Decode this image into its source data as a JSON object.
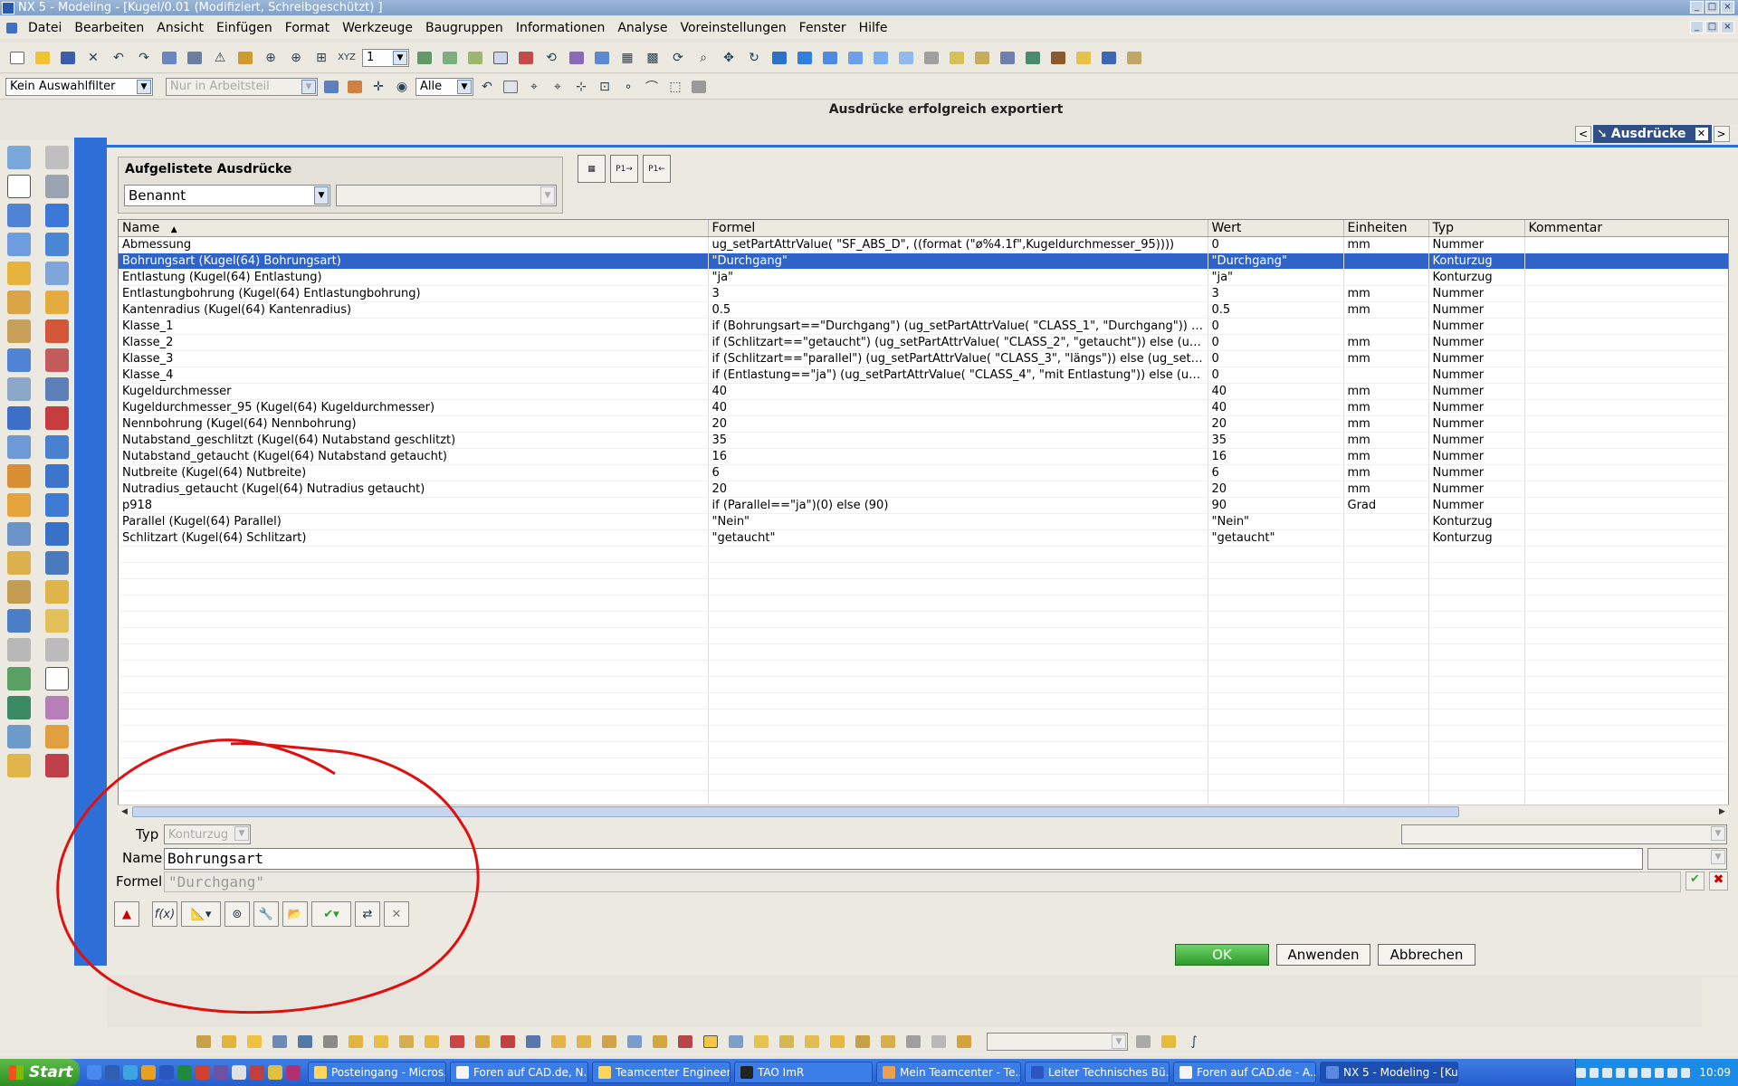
{
  "window": {
    "title": "NX 5 - Modeling - [Kugel/0.01 (Modifiziert, Schreibgeschützt) ]"
  },
  "menu": [
    "Datei",
    "Bearbeiten",
    "Ansicht",
    "Einfügen",
    "Format",
    "Werkzeuge",
    "Baugruppen",
    "Informationen",
    "Analyse",
    "Voreinstellungen",
    "Fenster",
    "Hilfe"
  ],
  "toolbar2": {
    "filter": "Kein Auswahlfilter",
    "workpart": "Nur in Arbeitsteil",
    "scope": "Alle",
    "layer": "1"
  },
  "status_message": "Ausdrücke erfolgreich exportiert",
  "resource_bar": {
    "label": "Ausdrücke"
  },
  "dialog": {
    "filter_group_label": "Aufgelistete Ausdrücke",
    "filter_value": "Benannt",
    "columns": [
      "Name",
      "Formel",
      "Wert",
      "Einheiten",
      "Typ",
      "Kommentar"
    ],
    "rows": [
      {
        "name": "Abmessung",
        "formula": "ug_setPartAttrValue( \"SF_ABS_D\", ((format (\"ø%4.1f\",Kugeldurchmesser_95))))",
        "value": "0",
        "unit": "mm",
        "type": "Nummer",
        "comment": ""
      },
      {
        "name": "Bohrungsart  (Kugel(64) Bohrungsart)",
        "formula": "\"Durchgang\"",
        "value": "\"Durchgang\"",
        "unit": "",
        "type": "Konturzug",
        "comment": "",
        "selected": true
      },
      {
        "name": "Entlastung  (Kugel(64) Entlastung)",
        "formula": "\"ja\"",
        "value": "\"ja\"",
        "unit": "",
        "type": "Konturzug",
        "comment": ""
      },
      {
        "name": "Entlastungbohrung  (Kugel(64) Entlastungbohrung)",
        "formula": "3",
        "value": "3",
        "unit": "mm",
        "type": "Nummer",
        "comment": ""
      },
      {
        "name": "Kantenradius  (Kugel(64) Kantenradius)",
        "formula": "0.5",
        "value": "0.5",
        "unit": "mm",
        "type": "Nummer",
        "comment": ""
      },
      {
        "name": "Klasse_1",
        "formula": "if (Bohrungsart==\"Durchgang\") (ug_setPartAttrValue( \"CLASS_1\", \"Durchgang\")) else (if...",
        "value": "0",
        "unit": "",
        "type": "Nummer",
        "comment": ""
      },
      {
        "name": "Klasse_2",
        "formula": "if (Schlitzart==\"getaucht\") (ug_setPartAttrValue( \"CLASS_2\", \"getaucht\")) else (ug_setP...",
        "value": "0",
        "unit": "mm",
        "type": "Nummer",
        "comment": ""
      },
      {
        "name": "Klasse_3",
        "formula": "if (Schlitzart==\"parallel\") (ug_setPartAttrValue( \"CLASS_3\", \"längs\")) else (ug_setPartAtt...",
        "value": "0",
        "unit": "mm",
        "type": "Nummer",
        "comment": ""
      },
      {
        "name": "Klasse_4",
        "formula": "if (Entlastung==\"ja\") (ug_setPartAttrValue( \"CLASS_4\", \"mit Entlastung\")) else (ug_setPa...",
        "value": "0",
        "unit": "",
        "type": "Nummer",
        "comment": ""
      },
      {
        "name": "Kugeldurchmesser",
        "formula": "40",
        "value": "40",
        "unit": "mm",
        "type": "Nummer",
        "comment": ""
      },
      {
        "name": "Kugeldurchmesser_95  (Kugel(64) Kugeldurchmesser)",
        "formula": "40",
        "value": "40",
        "unit": "mm",
        "type": "Nummer",
        "comment": ""
      },
      {
        "name": "Nennbohrung  (Kugel(64) Nennbohrung)",
        "formula": "20",
        "value": "20",
        "unit": "mm",
        "type": "Nummer",
        "comment": ""
      },
      {
        "name": "Nutabstand_geschlitzt  (Kugel(64) Nutabstand geschlitzt)",
        "formula": "35",
        "value": "35",
        "unit": "mm",
        "type": "Nummer",
        "comment": ""
      },
      {
        "name": "Nutabstand_getaucht  (Kugel(64) Nutabstand getaucht)",
        "formula": "16",
        "value": "16",
        "unit": "mm",
        "type": "Nummer",
        "comment": ""
      },
      {
        "name": "Nutbreite  (Kugel(64) Nutbreite)",
        "formula": "6",
        "value": "6",
        "unit": "mm",
        "type": "Nummer",
        "comment": ""
      },
      {
        "name": "Nutradius_getaucht  (Kugel(64) Nutradius getaucht)",
        "formula": "20",
        "value": "20",
        "unit": "mm",
        "type": "Nummer",
        "comment": ""
      },
      {
        "name": "p918",
        "formula": "if (Parallel==\"ja\")(0) else (90)",
        "value": "90",
        "unit": "Grad",
        "type": "Nummer",
        "comment": ""
      },
      {
        "name": "Parallel  (Kugel(64) Parallel)",
        "formula": "\"Nein\"",
        "value": "\"Nein\"",
        "unit": "",
        "type": "Konturzug",
        "comment": ""
      },
      {
        "name": "Schlitzart  (Kugel(64) Schlitzart)",
        "formula": "\"getaucht\"",
        "value": "\"getaucht\"",
        "unit": "",
        "type": "Konturzug",
        "comment": ""
      }
    ],
    "typ_label": "Typ",
    "typ_value": "Konturzug",
    "name_label": "Name",
    "name_value": "Bohrungsart",
    "formel_label": "Formel",
    "formel_value": "\"Durchgang\"",
    "ok": "OK",
    "apply": "Anwenden",
    "cancel": "Abbrechen"
  },
  "taskbar": {
    "start": "Start",
    "tasks": [
      "Posteingang - Micros...",
      "Foren auf CAD.de, N...",
      "Teamcenter Engineeri...",
      "TAO ImR",
      "Mein Teamcenter - Te...",
      "Leiter Technisches Bü...",
      "Foren auf CAD.de - A...",
      "NX 5 - Modeling - [Ku..."
    ],
    "clock": "10:09"
  },
  "colors": {
    "selection": "#2f63c8",
    "accent_blue": "#2d6fd6",
    "ok_green": "#3fae3a",
    "annotation_red": "#e01010"
  }
}
